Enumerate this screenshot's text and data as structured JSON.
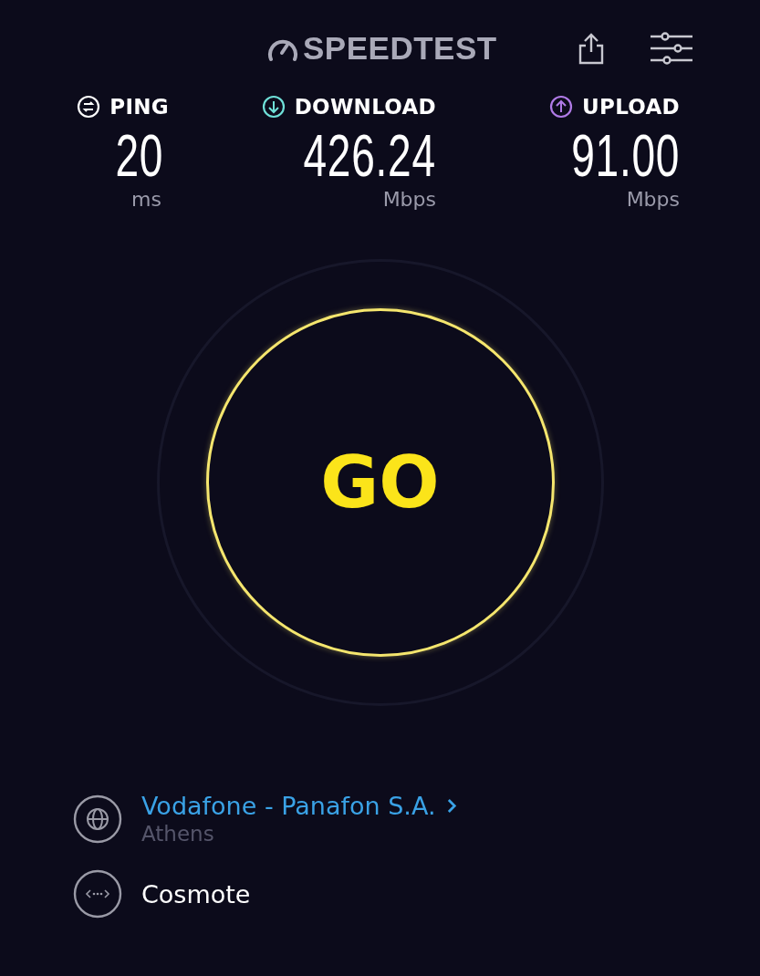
{
  "header": {
    "logo": "SPEEDTEST"
  },
  "metrics": [
    {
      "kind": "ping",
      "label": "PING",
      "value": "20",
      "unit": "ms",
      "color": "#ffffff"
    },
    {
      "kind": "download",
      "label": "DOWNLOAD",
      "value": "426.24",
      "unit": "Mbps",
      "color": "#6fe0d8"
    },
    {
      "kind": "upload",
      "label": "UPLOAD",
      "value": "91.00",
      "unit": "Mbps",
      "color": "#b07ae6"
    }
  ],
  "go_button": {
    "label": "GO"
  },
  "connections": [
    {
      "kind": "server",
      "name": "Vodafone - Panafon S.A.",
      "location": "Athens",
      "link": true
    },
    {
      "kind": "provider",
      "name": "Cosmote",
      "link": false
    }
  ]
}
